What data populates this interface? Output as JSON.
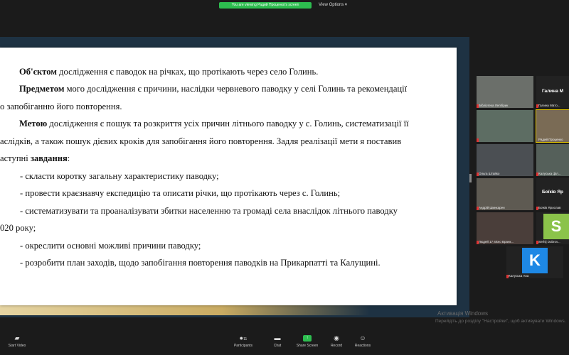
{
  "top": {
    "share_banner": "You are viewing Радий Проценко's screen",
    "view_options": "View Options ▾"
  },
  "slide": {
    "p1_bold": "Об'єктом",
    "p1_rest": " дослідження є паводок на річках, що протікають через село Голинь.",
    "p2_bold": "Предметом",
    "p2_rest": " мого дослідження є причини, наслідки червневого паводку у селі Голинь та рекомендації",
    "p3": "о запобіганню його повторення.",
    "p4_bold": "Метою",
    "p4_rest": " дослідження є пошук та розкриття усіх причин літнього паводку у с. Голинь, систематизації її",
    "p5": "аслідків, а також пошук дієвих кроків для запобігання його повторення. Задля реалізації мети я поставив",
    "p6_pre": "аступні ",
    "p6_bold": "завдання",
    "p6_post": ":",
    "items": [
      "- скласти коротку загальну характеристику паводку;",
      "- провести краєзнавчу експедицію та описати річки, що протікають через с. Голинь;",
      "- систематизувати та проаналізувати збитки населенню та громаді села внаслідок літнього паводку",
      "020 року;",
      "- окреслити основні можливі причини паводку;",
      "- розробити план заходів, щодо запобігання повторення паводків на Прикарпатті та Калущині."
    ]
  },
  "gallery": {
    "tiles": [
      "Бібліотека Лелібрик",
      "Галина М...",
      "Галина Мато...",
      "",
      "Радий Проценко",
      "Ольга Штайко",
      "Калуська філ...",
      "Андрій Шинкарен",
      "Боїків Ярослав",
      "Людей 17 вікно Вранк...",
      "Serhij Dubrov...",
      "Калуська Ana"
    ],
    "big_name": "Галина  М",
    "big_name2": "Боїків  Яр",
    "avatar_s": "S",
    "avatar_k": "K"
  },
  "watermark": {
    "line1": "Активація Windows",
    "line2": "Перейдіть до розділу \"Настройки\", щоб активувати Windows."
  },
  "toolbar": {
    "start_video": "Start Video",
    "participants": "Participants",
    "participants_count": "11",
    "chat": "Chat",
    "share_screen": "Share Screen",
    "record": "Record",
    "reactions": "Reactions"
  },
  "colors": {
    "share_green": "#2dbd4f",
    "slide_bg": "#1e3243"
  }
}
